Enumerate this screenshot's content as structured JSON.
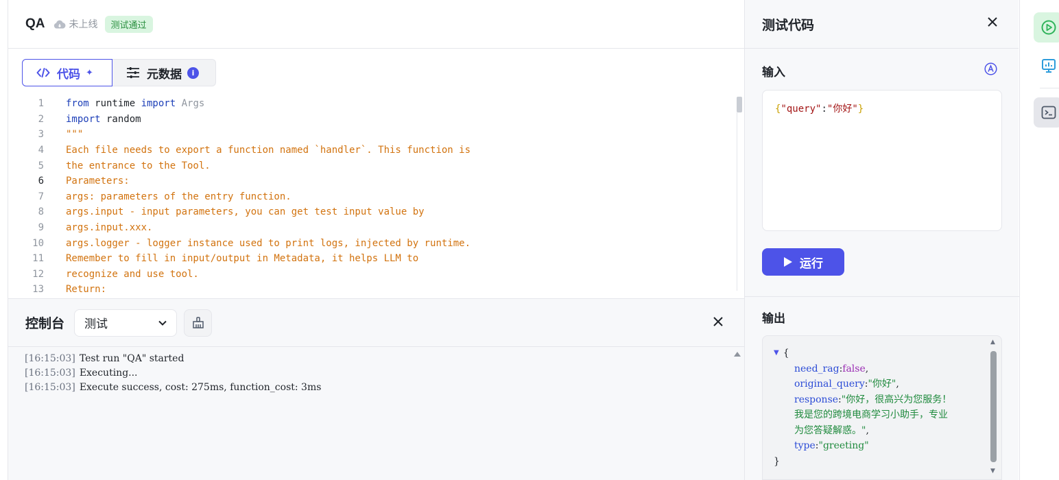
{
  "header": {
    "title": "QA",
    "status": "未上线",
    "badge": "测试通过"
  },
  "tabs": [
    {
      "label": "代码",
      "icon": "code-icon"
    },
    {
      "label": "元数据",
      "icon": "sliders-icon",
      "info": "i"
    }
  ],
  "editor": {
    "lines": [
      {
        "n": "1",
        "tokens": [
          [
            "kw",
            "from"
          ],
          [
            "plain",
            " runtime "
          ],
          [
            "kw",
            "import"
          ],
          [
            "dim",
            " Args"
          ]
        ]
      },
      {
        "n": "2",
        "tokens": [
          [
            "kw",
            "import"
          ],
          [
            "plain",
            " random"
          ]
        ]
      },
      {
        "n": "3",
        "tokens": [
          [
            "doc",
            "\"\"\""
          ]
        ]
      },
      {
        "n": "4",
        "tokens": [
          [
            "doc",
            "Each file needs to export a function named `handler`. This function is"
          ]
        ]
      },
      {
        "n": "5",
        "tokens": [
          [
            "doc",
            "the entrance to the Tool."
          ]
        ]
      },
      {
        "n": "6",
        "tokens": [
          [
            "doc",
            "Parameters:"
          ]
        ]
      },
      {
        "n": "7",
        "tokens": [
          [
            "doc",
            "args: parameters of the entry function."
          ]
        ]
      },
      {
        "n": "8",
        "tokens": [
          [
            "doc",
            "args.input - input parameters, you can get test input value by"
          ]
        ]
      },
      {
        "n": "9",
        "tokens": [
          [
            "doc",
            "args.input.xxx."
          ]
        ]
      },
      {
        "n": "10",
        "tokens": [
          [
            "doc",
            "args.logger - logger instance used to print logs, injected by runtime."
          ]
        ]
      },
      {
        "n": "11",
        "tokens": [
          [
            "doc",
            "Remember to fill in input/output in Metadata, it helps LLM to"
          ]
        ]
      },
      {
        "n": "12",
        "tokens": [
          [
            "doc",
            "recognize and use tool."
          ]
        ]
      },
      {
        "n": "13",
        "tokens": [
          [
            "doc",
            "Return:"
          ]
        ]
      }
    ],
    "current_line": "6"
  },
  "console": {
    "title": "控制台",
    "select_value": "测试",
    "logs": [
      {
        "ts": "[16:15:03]",
        "msg": "Test run \"QA\" started"
      },
      {
        "ts": "[16:15:03]",
        "msg": "Executing..."
      },
      {
        "ts": "[16:15:03]",
        "msg": "Execute success, cost: 275ms, function_cost: 3ms"
      }
    ]
  },
  "panel": {
    "title": "测试代码",
    "input_label": "输入",
    "input_json": {
      "open": "{",
      "key": "\"query\"",
      "colon": ":",
      "value": "\"你好\"",
      "close": "}"
    },
    "run_label": "运行",
    "output_label": "输出",
    "output": {
      "open": "{",
      "close": "}",
      "need_rag_key": "need_rag",
      "need_rag_val": "false",
      "original_query_key": "original_query",
      "original_query_val": "\"你好\"",
      "response_key": "response",
      "response_val_1": "\"你好，很高兴为您服务！",
      "response_val_2": "我是您的跨境电商学习小助手，专业",
      "response_val_3": "为您答疑解惑。\"",
      "type_key": "type",
      "type_val": "\"greeting\""
    }
  },
  "colors": {
    "accent": "#4d53e8",
    "success_bg": "#d9f5e0",
    "success_text": "#2a8f3f"
  }
}
